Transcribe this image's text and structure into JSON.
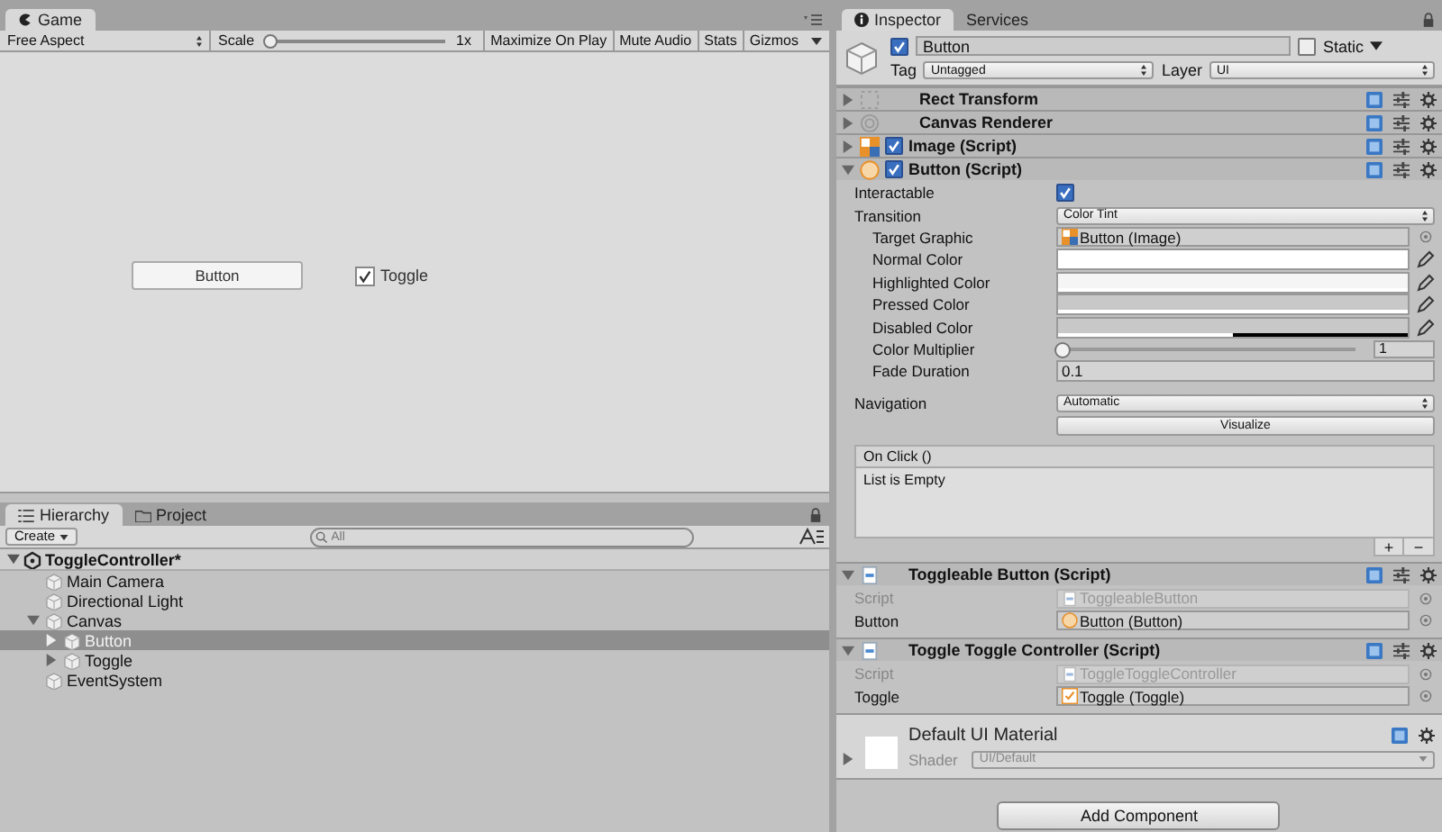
{
  "game": {
    "tab": "Game",
    "aspect": "Free Aspect",
    "scale_label": "Scale",
    "scale": {
      "level": 0
    },
    "scale_value": "1x",
    "buttons": [
      "Maximize On Play",
      "Mute Audio",
      "Stats",
      "Gizmos"
    ],
    "scene": {
      "button": "Button",
      "toggle": {
        "label": "Toggle",
        "checked": true
      }
    }
  },
  "hierarchy": {
    "tabs": [
      {
        "label": "Hierarchy",
        "selected": true
      },
      {
        "label": "Project",
        "selected": false
      }
    ],
    "create": "Create",
    "search": {
      "placeholder": "All"
    },
    "scene": "ToggleController*",
    "items": [
      {
        "name": "Main Camera",
        "selected": false
      },
      {
        "name": "Directional Light",
        "selected": false
      },
      {
        "name": "Canvas",
        "selected": false,
        "expanded": true,
        "children": [
          {
            "name": "Button",
            "selected": true,
            "expanded": false
          },
          {
            "name": "Toggle",
            "selected": false,
            "expanded": false
          }
        ]
      },
      {
        "name": "EventSystem",
        "selected": false
      }
    ]
  },
  "inspector": {
    "tabs": [
      {
        "label": "Inspector",
        "selected": true
      },
      {
        "label": "Services",
        "selected": false
      }
    ],
    "object": {
      "active": true,
      "name": "Button",
      "static_label": "Static",
      "static": false,
      "tag_label": "Tag",
      "tag": "Untagged",
      "layer_label": "Layer",
      "layer": "UI"
    },
    "components": [
      {
        "kind": "transform",
        "title": "Rect Transform",
        "expanded": false
      },
      {
        "kind": "renderer",
        "title": "Canvas Renderer",
        "expanded": false
      },
      {
        "kind": "image",
        "title": "Image (Script)",
        "expanded": false,
        "enabled": true
      },
      {
        "kind": "button",
        "title": "Button (Script)",
        "expanded": true,
        "enabled": true,
        "fields": [
          {
            "kind": "checkbox",
            "label": "Interactable",
            "checked": true
          },
          {
            "kind": "dropdown",
            "label": "Transition",
            "value": "Color Tint",
            "children": [
              {
                "kind": "image-ref",
                "label": "Target Graphic",
                "value": "Button (Image)"
              },
              {
                "kind": "color",
                "label": "Normal Color",
                "color": "#ffffff",
                "level": 1
              },
              {
                "kind": "color",
                "label": "Highlighted Color",
                "color": "#f5f5f5",
                "level": 1
              },
              {
                "kind": "color",
                "label": "Pressed Color",
                "color": "#c8c8c8",
                "level": 1
              },
              {
                "kind": "color",
                "label": "Disabled Color",
                "color": "#c8c8c8",
                "level": 0.5
              },
              {
                "kind": "slider",
                "label": "Color Multiplier",
                "level": 0,
                "reading": "1"
              },
              {
                "kind": "text",
                "label": "Fade Duration",
                "value": "0.1"
              }
            ]
          }
        ],
        "navigation": {
          "label": "Navigation",
          "value": "Automatic",
          "button": "Visualize"
        },
        "event": {
          "title": "On Click ()",
          "empty": "List is Empty",
          "add": "+",
          "remove": "−"
        }
      },
      {
        "kind": "script",
        "title": "Toggleable Button (Script)",
        "expanded": true,
        "fields": [
          {
            "kind": "script-ref",
            "label": "Script",
            "value": "ToggleableButton",
            "disabled": true
          },
          {
            "kind": "button-ref",
            "label": "Button",
            "value": "Button (Button)",
            "disabled": false
          }
        ]
      },
      {
        "kind": "script",
        "title": "Toggle Toggle Controller (Script)",
        "expanded": true,
        "fields": [
          {
            "kind": "script-ref",
            "label": "Script",
            "value": "ToggleToggleController",
            "disabled": true
          },
          {
            "kind": "toggle-ref",
            "label": "Toggle",
            "value": "Toggle (Toggle)",
            "disabled": false
          }
        ]
      }
    ],
    "material": {
      "name": "Default UI Material",
      "shader_label": "Shader",
      "shader": "UI/Default"
    },
    "add_component": "Add Component"
  }
}
